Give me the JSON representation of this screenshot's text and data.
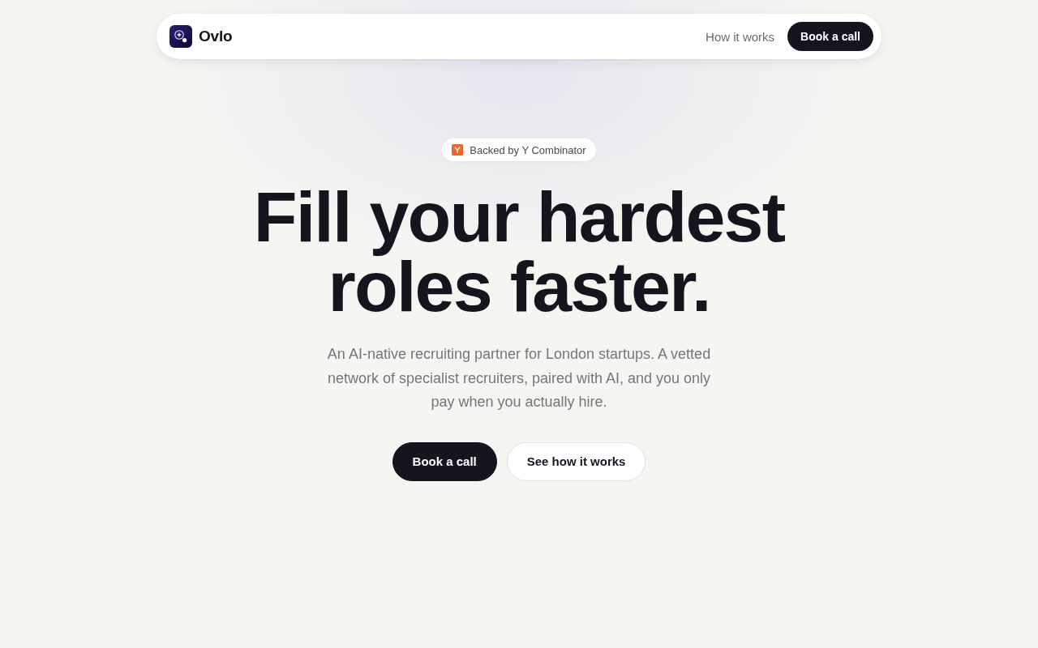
{
  "nav": {
    "brand": "Ovlo",
    "links": [
      {
        "label": "How it works"
      }
    ],
    "cta": "Book a call"
  },
  "hero": {
    "badge": "Backed by Y Combinator",
    "headline": "Fill your hardest roles faster.",
    "subtitle": "An AI-native recruiting partner for London startups. A vetted network of specialist recruiters, paired with AI, and you only pay when you actually hire.",
    "buttons": [
      {
        "label": "Book a call",
        "kind": "primary"
      },
      {
        "label": "See how it works",
        "kind": "secondary"
      }
    ]
  }
}
